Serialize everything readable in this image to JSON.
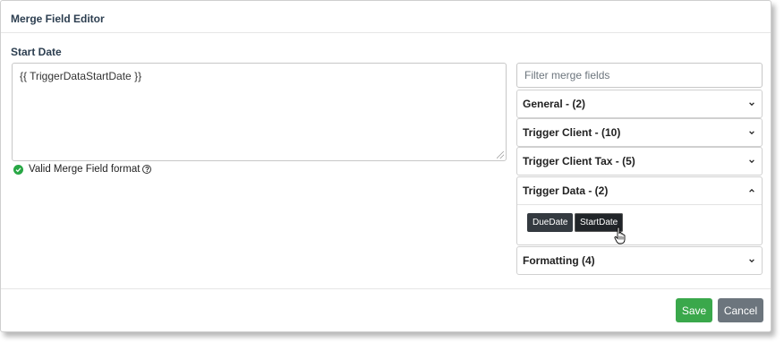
{
  "dialog": {
    "title": "Merge Field Editor"
  },
  "field": {
    "label": "Start Date",
    "value": "{{ TriggerDataStartDate }}",
    "validation_text": "Valid Merge Field format",
    "help_glyph": "?"
  },
  "filter": {
    "placeholder": "Filter merge fields",
    "value": ""
  },
  "groups": [
    {
      "label": "General - (2)",
      "expanded": false
    },
    {
      "label": "Trigger Client - (10)",
      "expanded": false
    },
    {
      "label": "Trigger Client Tax - (5)",
      "expanded": false
    },
    {
      "label": "Trigger Data - (2)",
      "expanded": true,
      "items": [
        "DueDate",
        "StartDate"
      ]
    },
    {
      "label": "Formatting (4)",
      "expanded": false
    }
  ],
  "buttons": {
    "save": "Save",
    "cancel": "Cancel"
  },
  "colors": {
    "save": "#3aa84b",
    "cancel": "#6c757d",
    "chip": "#343a40",
    "valid": "#28a745",
    "title": "#2c3e50"
  },
  "icons": [
    "check-circle-icon",
    "question-circle-icon",
    "chevron-down-icon",
    "chevron-up-icon",
    "hand-pointer-cursor"
  ]
}
